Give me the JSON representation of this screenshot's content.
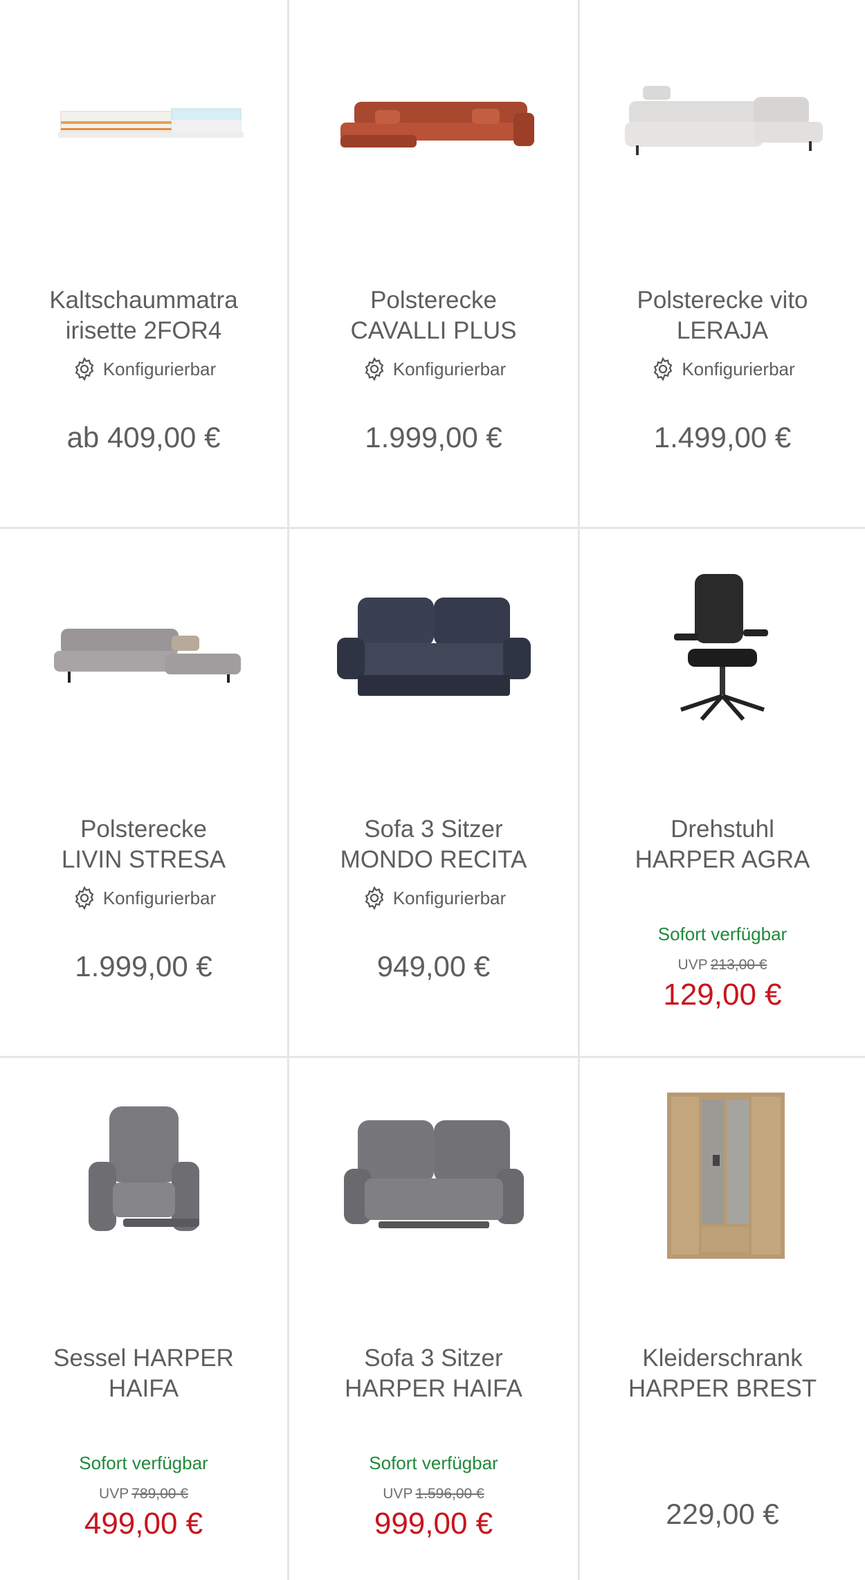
{
  "colors": {
    "available": "#1f8a3a",
    "sale": "#c8141e",
    "text": "#5e5e5e",
    "divider": "#e6e6e6"
  },
  "products": [
    {
      "title_l1": "Kaltschaummatra",
      "title_l2": "irisette 2FOR4",
      "config_label": "Konfigurierbar",
      "config_icon": "gear-icon",
      "price": "ab 409,00 €"
    },
    {
      "title_l1": "Polsterecke",
      "title_l2": "CAVALLI PLUS",
      "config_label": "Konfigurierbar",
      "config_icon": "gear-icon",
      "price": "1.999,00 €"
    },
    {
      "title_l1": "Polsterecke vito",
      "title_l2": "LERAJA",
      "config_label": "Konfigurierbar",
      "config_icon": "gear-icon",
      "price": "1.499,00 €"
    },
    {
      "title_l1": "Polsterecke",
      "title_l2": "LIVIN STRESA",
      "config_label": "Konfigurierbar",
      "config_icon": "gear-icon",
      "price": "1.999,00 €"
    },
    {
      "title_l1": "Sofa 3 Sitzer",
      "title_l2": "MONDO RECITA",
      "config_label": "Konfigurierbar",
      "config_icon": "gear-icon",
      "price": "949,00 €"
    },
    {
      "title_l1": "Drehstuhl",
      "title_l2": "HARPER AGRA",
      "availability": "Sofort verfügbar",
      "uvp_label": "UVP",
      "uvp_price": "213,00 €",
      "sale_price": "129,00 €"
    },
    {
      "title_l1": "Sessel HARPER",
      "title_l2": "HAIFA",
      "availability": "Sofort verfügbar",
      "uvp_label": "UVP",
      "uvp_price": "789,00 €",
      "sale_price": "499,00 €"
    },
    {
      "title_l1": "Sofa 3 Sitzer",
      "title_l2": "HARPER HAIFA",
      "availability": "Sofort verfügbar",
      "uvp_label": "UVP",
      "uvp_price": "1.596,00 €",
      "sale_price": "999,00 €"
    },
    {
      "title_l1": "Kleiderschrank",
      "title_l2": "HARPER BREST",
      "price": "229,00 €"
    }
  ]
}
